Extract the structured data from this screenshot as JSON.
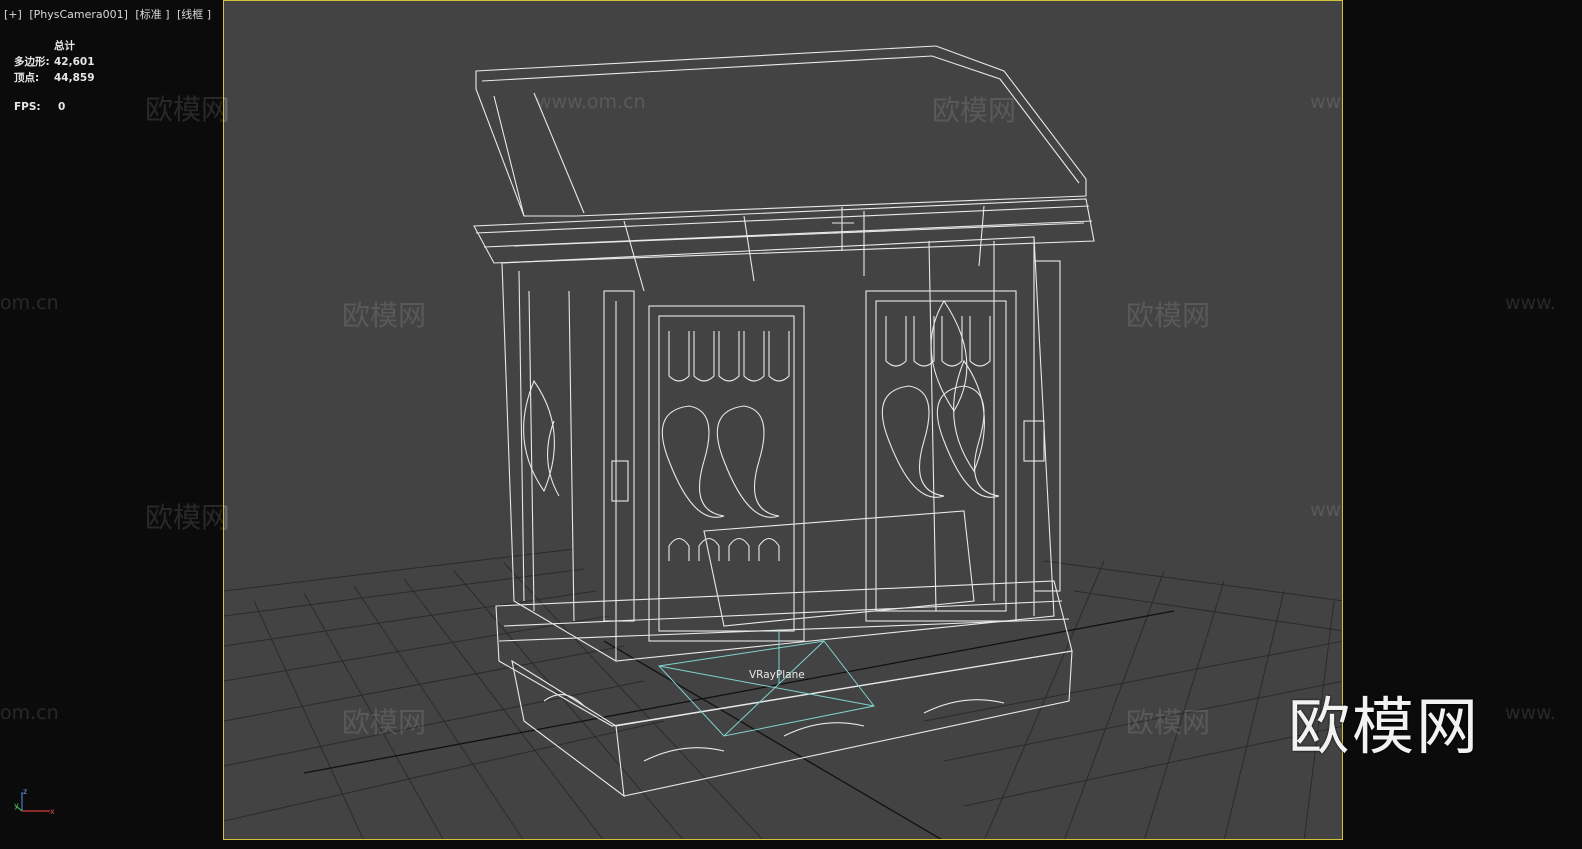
{
  "viewport": {
    "menu_label": "[+]",
    "camera_label": "[PhysCamera001]",
    "shading_label": "[标准 ]",
    "display_label": "[线框 ]"
  },
  "stats": {
    "header": "总计",
    "polygons_label": "多边形:",
    "polygons_value": "42,601",
    "vertices_label": "顶点:",
    "vertices_value": "44,859",
    "fps_label": "FPS:",
    "fps_value": "0"
  },
  "scene": {
    "object_label": "VRayPlane",
    "frame_color": "#d2c43a",
    "wire_color": "#e8e8e8"
  },
  "watermarks": {
    "cn": "欧模网",
    "url": "www.om.cn",
    "url_partial_left": "om.cn",
    "url_partial_right": "www."
  },
  "brand_logo": "欧模网",
  "axis": {
    "z": "z",
    "x": "x",
    "y": "y"
  }
}
